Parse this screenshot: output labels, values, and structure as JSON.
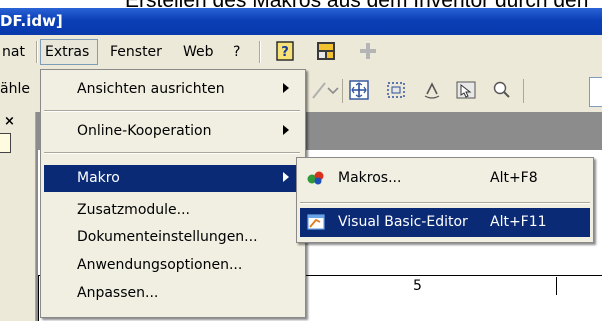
{
  "caption": {
    "text": "Erstellen des Makros aus dem Inventor durch den"
  },
  "window": {
    "title": "DF.idw]"
  },
  "menubar": {
    "format_label": "nat",
    "extras_label": "Extras",
    "fenster_label": "Fenster",
    "web_label": "Web",
    "help_label": "?"
  },
  "toolbar": {
    "select_label": "ähle"
  },
  "leftpanel": {
    "close_label": "×"
  },
  "sheet": {
    "ruler_number": "5"
  },
  "extras_menu": {
    "items": [
      {
        "label": "Ansichten ausrichten",
        "has_submenu": true
      },
      {
        "label": "Online-Kooperation",
        "has_submenu": true
      },
      {
        "label": "Makro",
        "has_submenu": true,
        "highlighted": true
      },
      {
        "label": "Zusatzmodule...",
        "has_submenu": false
      },
      {
        "label": "Dokumenteinstellungen...",
        "has_submenu": false
      },
      {
        "label": "Anwendungsoptionen...",
        "has_submenu": false
      },
      {
        "label": "Anpassen...",
        "has_submenu": false
      }
    ]
  },
  "makro_submenu": {
    "items": [
      {
        "label": "Makros...",
        "shortcut": "Alt+F8",
        "icon": "makros-icon"
      },
      {
        "label": "Visual Basic-Editor",
        "shortcut": "Alt+F11",
        "icon": "vb-editor-icon",
        "highlighted": true
      }
    ]
  },
  "colors": {
    "title_bar": "#0b3fb6",
    "menu_bg": "#ece9d8",
    "highlight": "#0b2a75"
  }
}
